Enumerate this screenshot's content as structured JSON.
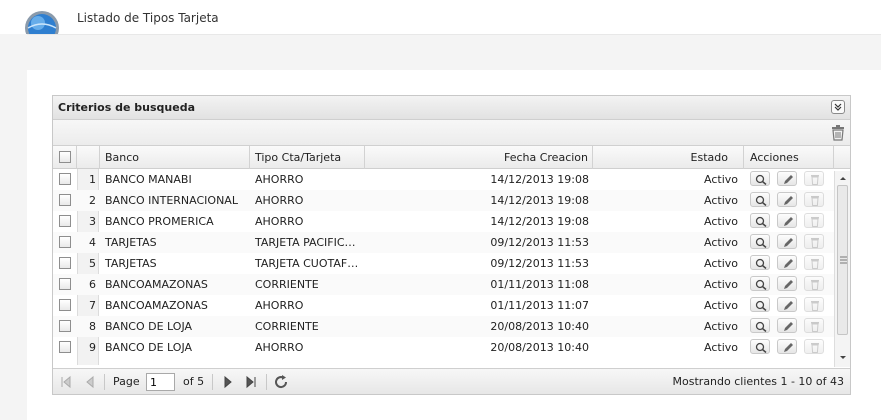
{
  "header": {
    "title": "Listado de Tipos Tarjeta"
  },
  "panel": {
    "title": "Criterios de busqueda",
    "columns": {
      "banco": "Banco",
      "tipo": "Tipo Cta/Tarjeta",
      "fecha": "Fecha Creacion",
      "estado": "Estado",
      "acciones": "Acciones"
    },
    "rows": [
      {
        "num": "1",
        "banco": "BANCO MANABI",
        "tipo": "AHORRO",
        "fecha": "14/12/2013 19:08",
        "estado": "Activo"
      },
      {
        "num": "2",
        "banco": "BANCO INTERNACIONAL",
        "tipo": "AHORRO",
        "fecha": "14/12/2013 19:08",
        "estado": "Activo"
      },
      {
        "num": "3",
        "banco": "BANCO PROMERICA",
        "tipo": "AHORRO",
        "fecha": "14/12/2013 19:08",
        "estado": "Activo"
      },
      {
        "num": "4",
        "banco": "TARJETAS",
        "tipo": "TARJETA PACIFIC…",
        "fecha": "09/12/2013 11:53",
        "estado": "Activo"
      },
      {
        "num": "5",
        "banco": "TARJETAS",
        "tipo": "TARJETA CUOTAF…",
        "fecha": "09/12/2013 11:53",
        "estado": "Activo"
      },
      {
        "num": "6",
        "banco": "BANCOAMAZONAS",
        "tipo": "CORRIENTE",
        "fecha": "01/11/2013 11:08",
        "estado": "Activo"
      },
      {
        "num": "7",
        "banco": "BANCOAMAZONAS",
        "tipo": "AHORRO",
        "fecha": "01/11/2013 11:07",
        "estado": "Activo"
      },
      {
        "num": "8",
        "banco": "BANCO DE LOJA",
        "tipo": "CORRIENTE",
        "fecha": "20/08/2013 10:40",
        "estado": "Activo"
      },
      {
        "num": "9",
        "banco": "BANCO DE LOJA",
        "tipo": "AHORRO",
        "fecha": "20/08/2013 10:40",
        "estado": "Activo"
      }
    ]
  },
  "pager": {
    "page_label": "Page",
    "page_value": "1",
    "of_label": "of 5",
    "status": "Mostrando clientes 1 - 10 of 43"
  },
  "icons": [
    "app-logo-icon",
    "collapse-icon",
    "delete-icon",
    "view-icon",
    "edit-icon",
    "first-page-icon",
    "prev-page-icon",
    "next-page-icon",
    "last-page-icon",
    "refresh-icon"
  ]
}
